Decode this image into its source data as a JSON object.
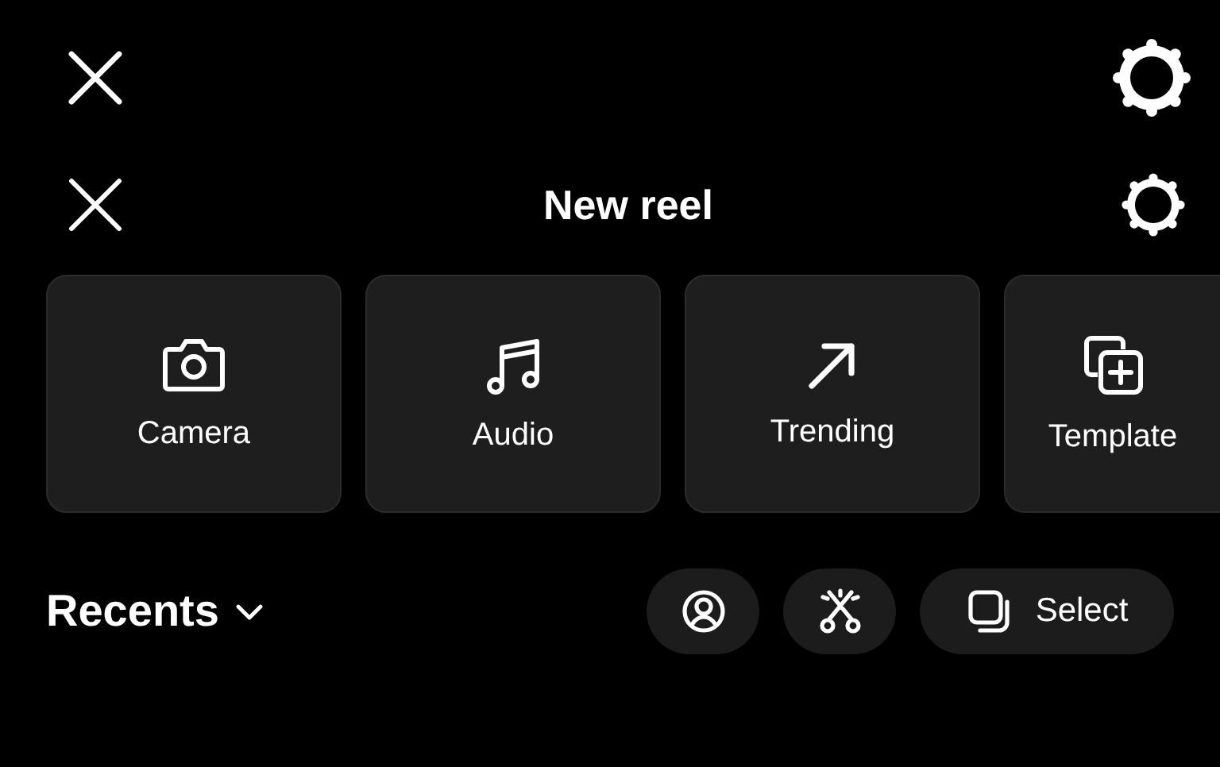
{
  "header": {
    "title": "New reel"
  },
  "tiles": [
    {
      "kind": "camera",
      "label": "Camera"
    },
    {
      "kind": "audio",
      "label": "Audio"
    },
    {
      "kind": "trending",
      "label": "Trending"
    },
    {
      "kind": "templates",
      "label": "Template"
    }
  ],
  "gallery": {
    "album": "Recents",
    "actions": [
      {
        "kind": "profile"
      },
      {
        "kind": "effects"
      },
      {
        "kind": "select",
        "label": "Select"
      }
    ]
  }
}
